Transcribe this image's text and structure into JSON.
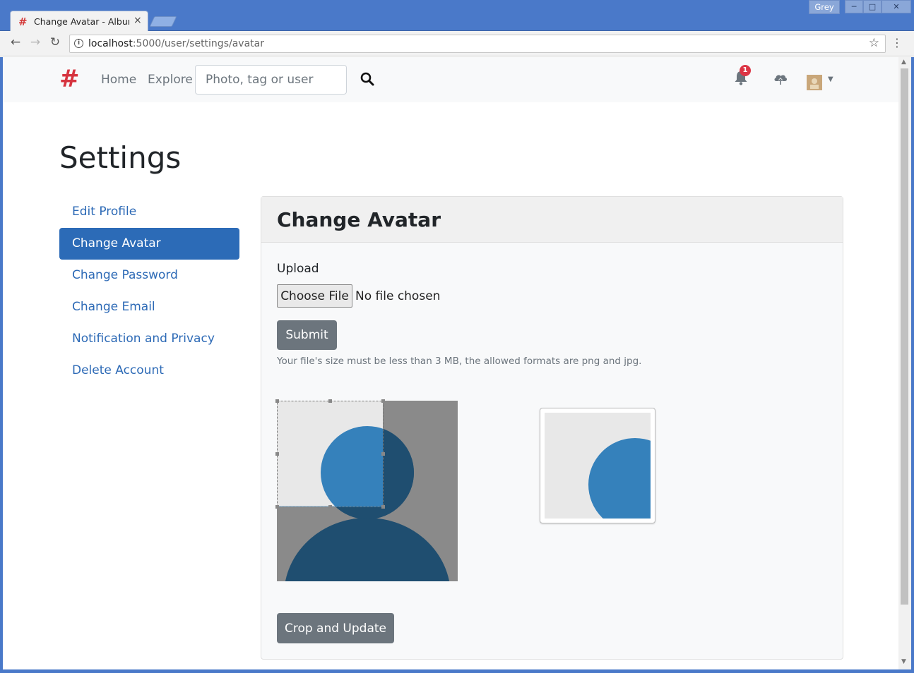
{
  "browser": {
    "tab_title": "Change Avatar - Album",
    "tab_close": "×",
    "window_user": "Grey",
    "url_host": "localhost",
    "url_rest": ":5000/user/settings/avatar",
    "icons": [
      "back-arrow-icon",
      "forward-arrow-icon",
      "reload-icon",
      "info-icon",
      "bookmark-star-icon",
      "menu-dots-icon"
    ]
  },
  "navbar": {
    "brand": "#",
    "links": [
      "Home",
      "Explore"
    ],
    "search_placeholder": "Photo, tag or user",
    "notification_count": "1",
    "icons": [
      "search-icon",
      "bell-icon",
      "upload-cloud-icon",
      "user-avatar",
      "caret-down-icon"
    ]
  },
  "settings": {
    "title": "Settings",
    "menu": [
      {
        "label": "Edit Profile",
        "active": false
      },
      {
        "label": "Change Avatar",
        "active": true
      },
      {
        "label": "Change Password",
        "active": false
      },
      {
        "label": "Change Email",
        "active": false
      },
      {
        "label": "Notification and Privacy",
        "active": false
      },
      {
        "label": "Delete Account",
        "active": false
      }
    ]
  },
  "card": {
    "title": "Change Avatar",
    "upload_label": "Upload",
    "choose_file_label": "Choose File",
    "file_status": "No file chosen",
    "submit_label": "Submit",
    "help_text": "Your file's size must be less than 3 MB, the allowed formats are png and jpg.",
    "crop_button_label": "Crop and Update"
  },
  "colors": {
    "primary": "#2c6bb7",
    "secondary_button": "#6c757d",
    "brand": "#d6343f",
    "badge": "#dc3545",
    "avatar_blue": "#3581bb",
    "avatar_dark": "#1f4e70"
  }
}
